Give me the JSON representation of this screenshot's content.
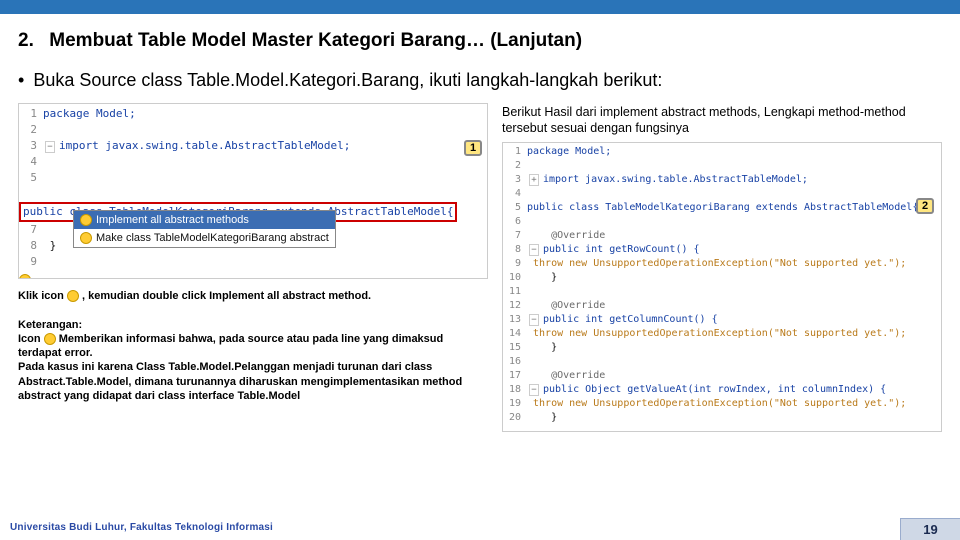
{
  "header": {
    "number": "2.",
    "title": "Membuat Table Model Master Kategori Barang… (Lanjutan)"
  },
  "bullet": "Buka Source class Table.Model.Kategori.Barang, ikuti langkah-langkah berikut:",
  "badges": {
    "one": "1",
    "two": "2"
  },
  "code1": {
    "l1": "package Model;",
    "l3": "import javax.swing.table.AbstractTableModel;",
    "l6": "public class TableModelKategoriBarang extends AbstractTableModel{",
    "popup_sel": "Implement all abstract methods",
    "popup_item2": "Make class TableModelKategoriBarang abstract"
  },
  "right_intro": "Berikut Hasil dari implement abstract methods, Lengkapi method-method tersebut sesuai dengan fungsinya",
  "code2": {
    "l1": "package Model;",
    "l3": "import javax.swing.table.AbstractTableModel;",
    "l5": "public class TableModelKategoriBarang extends AbstractTableModel{",
    "ov": "@Override",
    "m1a": "public int getRowCount() {",
    "m_throw": "    throw new UnsupportedOperationException(\"Not supported yet.\");",
    "m2a": "public int getColumnCount() {",
    "m3a": "public Object getValueAt(int rowIndex, int columnIndex) {"
  },
  "left_notes": {
    "l1a": "Klik icon ",
    "l1b": " , kemudian double click Implement all abstract method.",
    "k_head": "Keterangan:",
    "k1a": "Icon ",
    "k1b": "  Memberikan informasi bahwa, pada source atau pada line yang dimaksud terdapat error.",
    "k2": "Pada kasus ini karena Class Table.Model.Pelanggan menjadi turunan dari class Abstract.Table.Model, dimana turunannya diharuskan mengimplementasikan method abstract yang didapat dari class interface Table.Model"
  },
  "footer": {
    "left": "Universitas Budi Luhur, Fakultas Teknologi Informasi",
    "page": "19"
  }
}
